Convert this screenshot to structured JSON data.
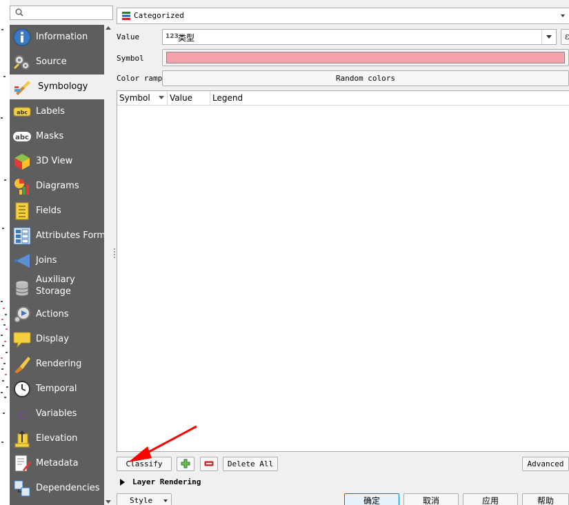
{
  "search": {
    "value": ""
  },
  "sidebar": {
    "items": [
      {
        "label": "Information",
        "icon": "info-icon"
      },
      {
        "label": "Source",
        "icon": "source-icon"
      },
      {
        "label": "Symbology",
        "icon": "symbology-icon",
        "active": true
      },
      {
        "label": "Labels",
        "icon": "labels-icon"
      },
      {
        "label": "Masks",
        "icon": "masks-icon"
      },
      {
        "label": "3D View",
        "icon": "3d-view-icon"
      },
      {
        "label": "Diagrams",
        "icon": "diagrams-icon"
      },
      {
        "label": "Fields",
        "icon": "fields-icon"
      },
      {
        "label": "Attributes Form",
        "icon": "attributes-form-icon"
      },
      {
        "label": "Joins",
        "icon": "joins-icon"
      },
      {
        "label": "Auxiliary\nStorage",
        "icon": "auxiliary-storage-icon"
      },
      {
        "label": "Actions",
        "icon": "actions-icon"
      },
      {
        "label": "Display",
        "icon": "display-icon"
      },
      {
        "label": "Rendering",
        "icon": "rendering-icon"
      },
      {
        "label": "Temporal",
        "icon": "temporal-icon"
      },
      {
        "label": "Variables",
        "icon": "variables-icon"
      },
      {
        "label": "Elevation",
        "icon": "elevation-icon"
      },
      {
        "label": "Metadata",
        "icon": "metadata-icon"
      },
      {
        "label": "Dependencies",
        "icon": "dependencies-icon"
      }
    ]
  },
  "symbology": {
    "renderer": "Categorized",
    "value_label": "Value",
    "value_type": "123",
    "value_field": "类型",
    "expression_button": "ε",
    "symbol_label": "Symbol",
    "symbol_color": "#f4a3ad",
    "color_ramp_label": "Color ramp",
    "color_ramp_value": "Random colors",
    "table": {
      "columns": [
        "Symbol",
        "Value",
        "Legend"
      ],
      "rows": []
    },
    "buttons": {
      "classify": "Classify",
      "add": "+",
      "delete": "−",
      "delete_all": "Delete All",
      "advanced": "Advanced"
    },
    "layer_rendering": "Layer Rendering"
  },
  "footer": {
    "style": "Style",
    "ok": "确定",
    "cancel": "取消",
    "apply": "应用",
    "help": "帮助"
  },
  "colors": {
    "sidebar_bg": "#5e5e5e",
    "accent": "#0078d7",
    "annotation_arrow": "#ff0000"
  }
}
